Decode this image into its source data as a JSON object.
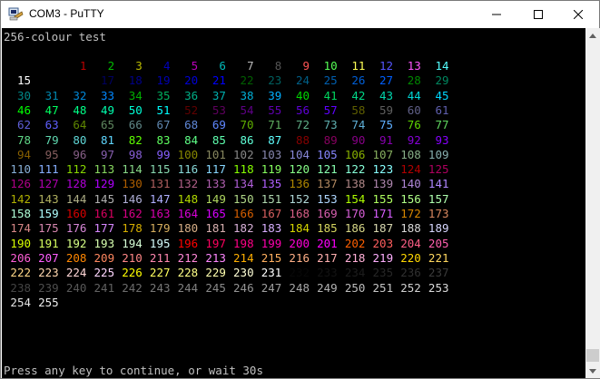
{
  "window": {
    "title": "COM3 - PuTTY"
  },
  "terminal": {
    "header": "256-colour test",
    "footer": "Press any key to continue, or wait 30s",
    "palette": [
      "#000000",
      "#bb0000",
      "#00bb00",
      "#bbbb00",
      "#0000bb",
      "#bb00bb",
      "#00bbbb",
      "#bbbbbb",
      "#555555",
      "#ff5555",
      "#55ff55",
      "#ffff55",
      "#5555ff",
      "#ff55ff",
      "#55ffff",
      "#ffffff"
    ]
  },
  "scrollbar": {
    "up_icon": "triangle-up",
    "down_icon": "triangle-down"
  }
}
